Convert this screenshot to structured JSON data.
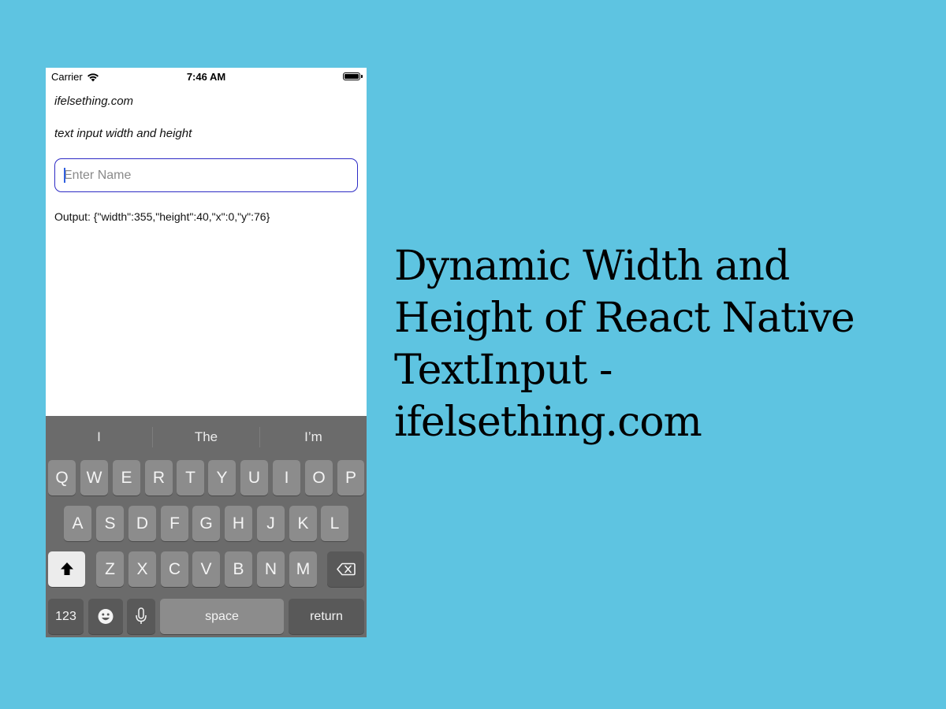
{
  "status_bar": {
    "carrier": "Carrier",
    "time": "7:46 AM"
  },
  "app": {
    "site": "ifelsething.com",
    "subtitle": "text input width and height",
    "input": {
      "placeholder": "Enter Name",
      "value": ""
    },
    "output": "Output: {\"width\":355,\"height\":40,\"x\":0,\"y\":76}"
  },
  "keyboard": {
    "suggestions": [
      "I",
      "The",
      "I’m"
    ],
    "row1": [
      "Q",
      "W",
      "E",
      "R",
      "T",
      "Y",
      "U",
      "I",
      "O",
      "P"
    ],
    "row2": [
      "A",
      "S",
      "D",
      "F",
      "G",
      "H",
      "J",
      "K",
      "L"
    ],
    "row3": [
      "Z",
      "X",
      "C",
      "V",
      "B",
      "N",
      "M"
    ],
    "numbers_label": "123",
    "space_label": "space",
    "return_label": "return",
    "icons": {
      "shift": "shift-icon",
      "delete": "delete-icon",
      "emoji": "emoji-icon",
      "mic": "microphone-icon"
    }
  },
  "headline": "Dynamic Width and Height of React Native TextInput - ifelsething.com",
  "colors": {
    "background": "#5ec4e1",
    "input_border": "#2d2bc5",
    "keyboard_bg": "#6b6b6b",
    "key_bg": "#8c8c8c"
  }
}
